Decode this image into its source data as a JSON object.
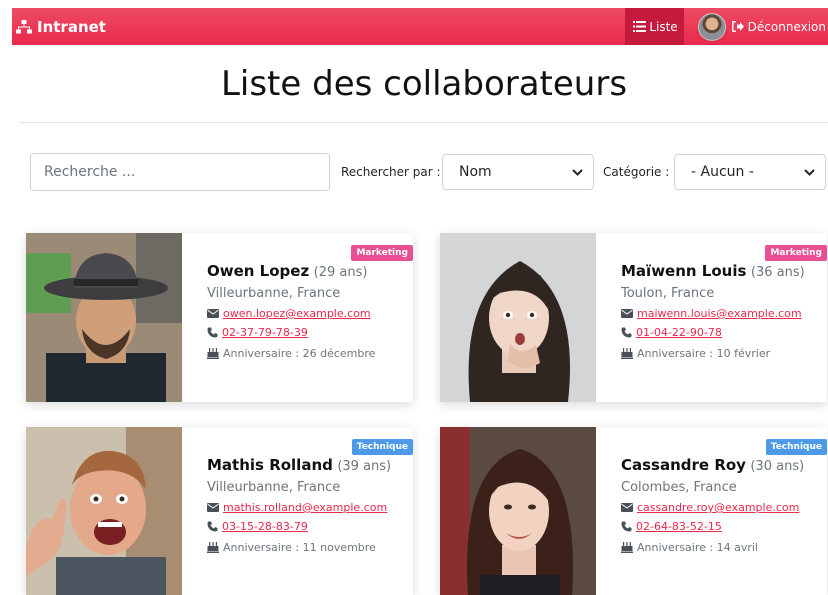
{
  "navbar": {
    "brand": "Intranet",
    "list_label": "Liste",
    "logout_label": "Déconnexion"
  },
  "page": {
    "title": "Liste des collaborateurs"
  },
  "filters": {
    "search_placeholder": "Recherche ...",
    "search_by_label": "Rechercher par :",
    "search_by_value": "Nom",
    "category_label": "Catégorie :",
    "category_value": "- Aucun -"
  },
  "employees": [
    {
      "name": "Owen Lopez",
      "age": "(29 ans)",
      "city": "Villeurbanne, France",
      "email": "owen.lopez@example.com",
      "phone": "02-37-79-78-39",
      "birthday": "Anniversaire : 26 décembre",
      "category": "Marketing"
    },
    {
      "name": "Maïwenn Louis",
      "age": "(36 ans)",
      "city": "Toulon, France",
      "email": "maiwenn.louis@example.com",
      "phone": "01-04-22-90-78",
      "birthday": "Anniversaire : 10 février",
      "category": "Marketing"
    },
    {
      "name": "Mathis Rolland",
      "age": "(39 ans)",
      "city": "Villeurbanne, France",
      "email": "mathis.rolland@example.com",
      "phone": "03-15-28-83-79",
      "birthday": "Anniversaire : 11 novembre",
      "category": "Technique"
    },
    {
      "name": "Cassandre Roy",
      "age": "(30 ans)",
      "city": "Colombes, France",
      "email": "cassandre.roy@example.com",
      "phone": "02-64-83-52-15",
      "birthday": "Anniversaire : 14 avril",
      "category": "Technique"
    }
  ],
  "colors": {
    "navbar": "#e8294b",
    "link": "#e8294b",
    "badge_marketing": "#e84f94",
    "badge_technique": "#4f9ae8"
  }
}
